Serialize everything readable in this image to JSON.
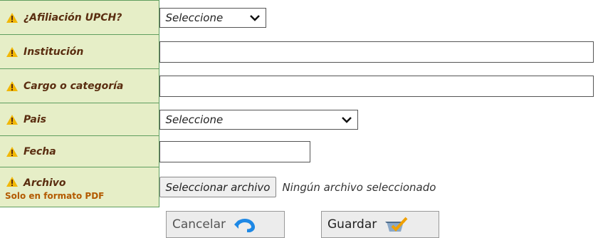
{
  "form": {
    "rows": [
      {
        "label": "¿Afiliación UPCH?"
      },
      {
        "label": "Institución"
      },
      {
        "label": "Cargo o categoría"
      },
      {
        "label": "Pais"
      },
      {
        "label": "Fecha"
      },
      {
        "label": "Archivo",
        "sublabel": "Solo en formato PDF"
      }
    ],
    "afiliacion_select": {
      "value": "Seleccione"
    },
    "institucion_input": {
      "value": ""
    },
    "cargo_input": {
      "value": ""
    },
    "pais_select": {
      "value": "Seleccione"
    },
    "fecha_input": {
      "value": ""
    },
    "archivo": {
      "button_label": "Seleccionar archivo",
      "status": "Ningún archivo seleccionado"
    }
  },
  "actions": {
    "cancel_label": "Cancelar",
    "save_label": "Guardar"
  },
  "icons": {
    "warning": "warning-icon",
    "undo": "undo-icon",
    "save": "save-icon"
  },
  "colors": {
    "label_bg": "#e6eec7",
    "label_border": "#5f9e5f",
    "label_text": "#5a2d10",
    "sublabel_text": "#b35a00",
    "undo_icon": "#1e88e5",
    "warning_icon": "#f2b705"
  }
}
